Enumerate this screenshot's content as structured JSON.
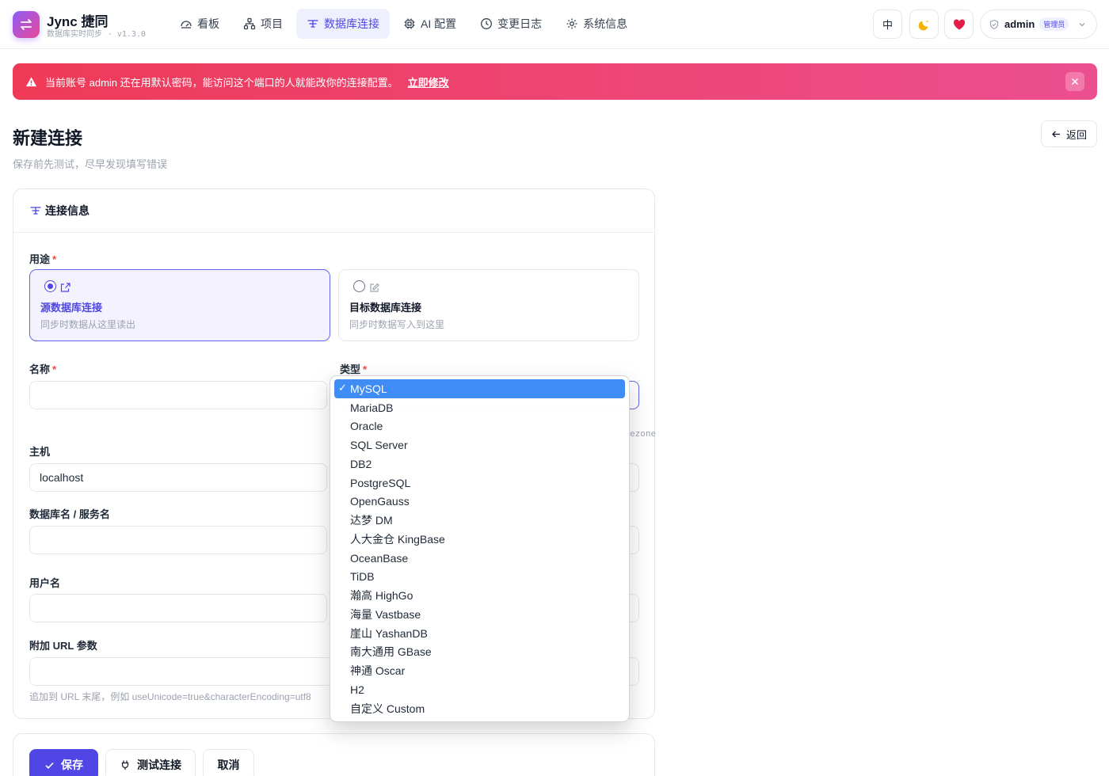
{
  "brand": {
    "title": "Jync 捷同",
    "subtitle": "数据库实时同步",
    "version": "v1.3.0"
  },
  "nav": [
    {
      "label": "看板",
      "icon": "dashboard-icon"
    },
    {
      "label": "项目",
      "icon": "project-icon"
    },
    {
      "label": "数据库连接",
      "icon": "database-connection-icon",
      "active": true
    },
    {
      "label": "AI 配置",
      "icon": "chip-icon"
    },
    {
      "label": "变更日志",
      "icon": "clock-icon"
    },
    {
      "label": "系统信息",
      "icon": "gear-icon"
    }
  ],
  "header": {
    "lang_label": "中",
    "user": "admin",
    "role": "管理员"
  },
  "alert": {
    "text": "当前账号 admin 还在用默认密码，能访问这个端口的人就能改你的连接配置。",
    "link": "立即修改"
  },
  "page": {
    "title": "新建连接",
    "subtitle": "保存前先测试，尽早发现填写错误",
    "back_label": "返回"
  },
  "form": {
    "section_title": "连接信息",
    "purpose_label": "用途",
    "purpose_options": [
      {
        "title": "源数据库连接",
        "desc": "同步时数据从这里读出",
        "selected": true
      },
      {
        "title": "目标数据库连接",
        "desc": "同步时数据写入到这里",
        "selected": false
      }
    ],
    "name_label": "名称",
    "type_label": "类型",
    "type_hint_fragment": "ezone",
    "host_label": "主机",
    "host_value": "localhost",
    "db_label": "数据库名 / 服务名",
    "user_label": "用户名",
    "url_label": "附加 URL 参数",
    "url_hint": "追加到 URL 末尾，例如 useUnicode=true&characterEncoding=utf8"
  },
  "actions": {
    "save": "保存",
    "test": "测试连接",
    "cancel": "取消"
  },
  "dropdown": {
    "selected": "MySQL",
    "options": [
      "MySQL",
      "MariaDB",
      "Oracle",
      "SQL Server",
      "DB2",
      "PostgreSQL",
      "OpenGauss",
      "达梦 DM",
      "人大金仓 KingBase",
      "OceanBase",
      "TiDB",
      "瀚高 HighGo",
      "海量 Vastbase",
      "崖山 YashanDB",
      "南大通用 GBase",
      "神通 Oscar",
      "H2",
      "自定义 Custom"
    ]
  },
  "colors": {
    "accent": "#4f46e5",
    "alert_start": "#ef3a57",
    "alert_end": "#ec4f8f",
    "selected_option": "#3f8cf5"
  }
}
